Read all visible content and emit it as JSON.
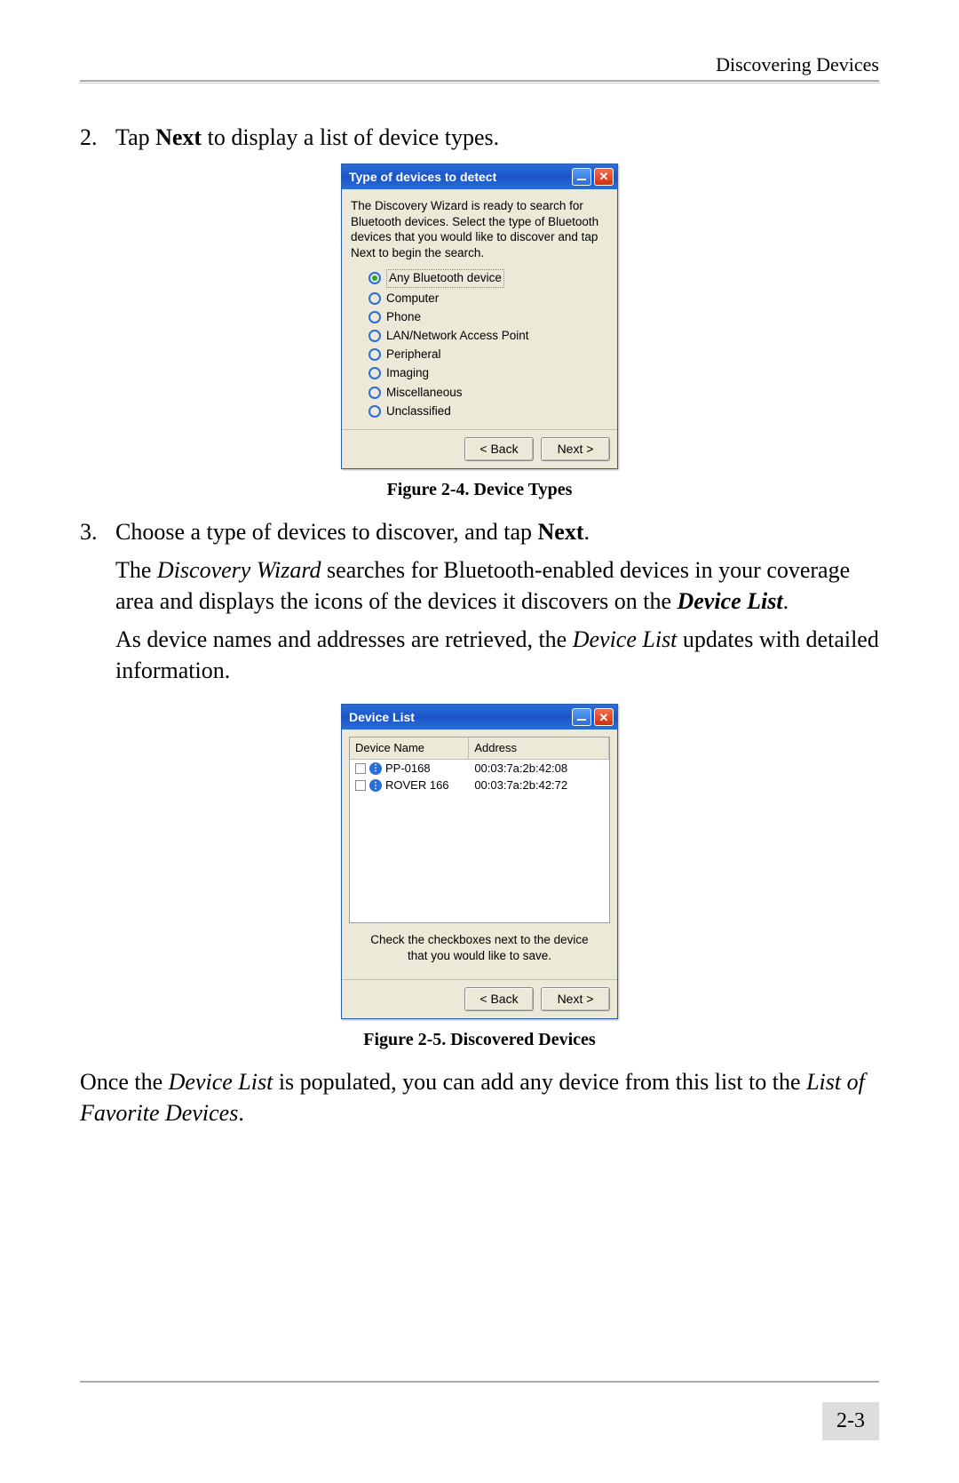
{
  "header": {
    "section_title": "Discovering Devices"
  },
  "step2": {
    "num": "2.",
    "text_before": "Tap ",
    "text_bold": "Next",
    "text_after": " to display a list of device types."
  },
  "dialog1": {
    "title": "Type of devices to detect",
    "wizard_text": "The Discovery Wizard is ready to search for Bluetooth devices. Select the type of Bluetooth devices that you would like to discover and tap Next to begin the search.",
    "options": [
      "Any Bluetooth device",
      "Computer",
      "Phone",
      "LAN/Network Access Point",
      "Peripheral",
      "Imaging",
      "Miscellaneous",
      "Unclassified"
    ],
    "selected_index": 0,
    "back": "< Back",
    "next": "Next >"
  },
  "caption1": "Figure 2-4. Device Types",
  "step3": {
    "num": "3.",
    "line1_before": "Choose a type of devices to discover, and tap ",
    "line1_bold": "Next",
    "line1_after": ".",
    "para2_a": "The ",
    "para2_i1": "Discovery Wizard",
    "para2_b": " searches for Bluetooth-enabled devices in your coverage area and displays the icons of the devices it discovers on the ",
    "para2_bi": "Device List",
    "para2_c": ".",
    "para3_a": "As device names and addresses are retrieved, the ",
    "para3_i": "Device List",
    "para3_b": " updates with detailed information."
  },
  "dialog2": {
    "title": "Device List",
    "col_name": "Device Name",
    "col_addr": "Address",
    "rows": [
      {
        "name": "PP-0168",
        "addr": "00:03:7a:2b:42:08"
      },
      {
        "name": "ROVER 166",
        "addr": "00:03:7a:2b:42:72"
      }
    ],
    "hint": "Check the checkboxes next to the device that you would like to save.",
    "back": "< Back",
    "next": "Next >"
  },
  "caption2": "Figure 2-5. Discovered Devices",
  "closing": {
    "a": "Once the ",
    "i1": "Device List",
    "b": " is populated, you can add any device from this list to the ",
    "i2": "List of Favorite Devices",
    "c": "."
  },
  "page_number": "2-3"
}
